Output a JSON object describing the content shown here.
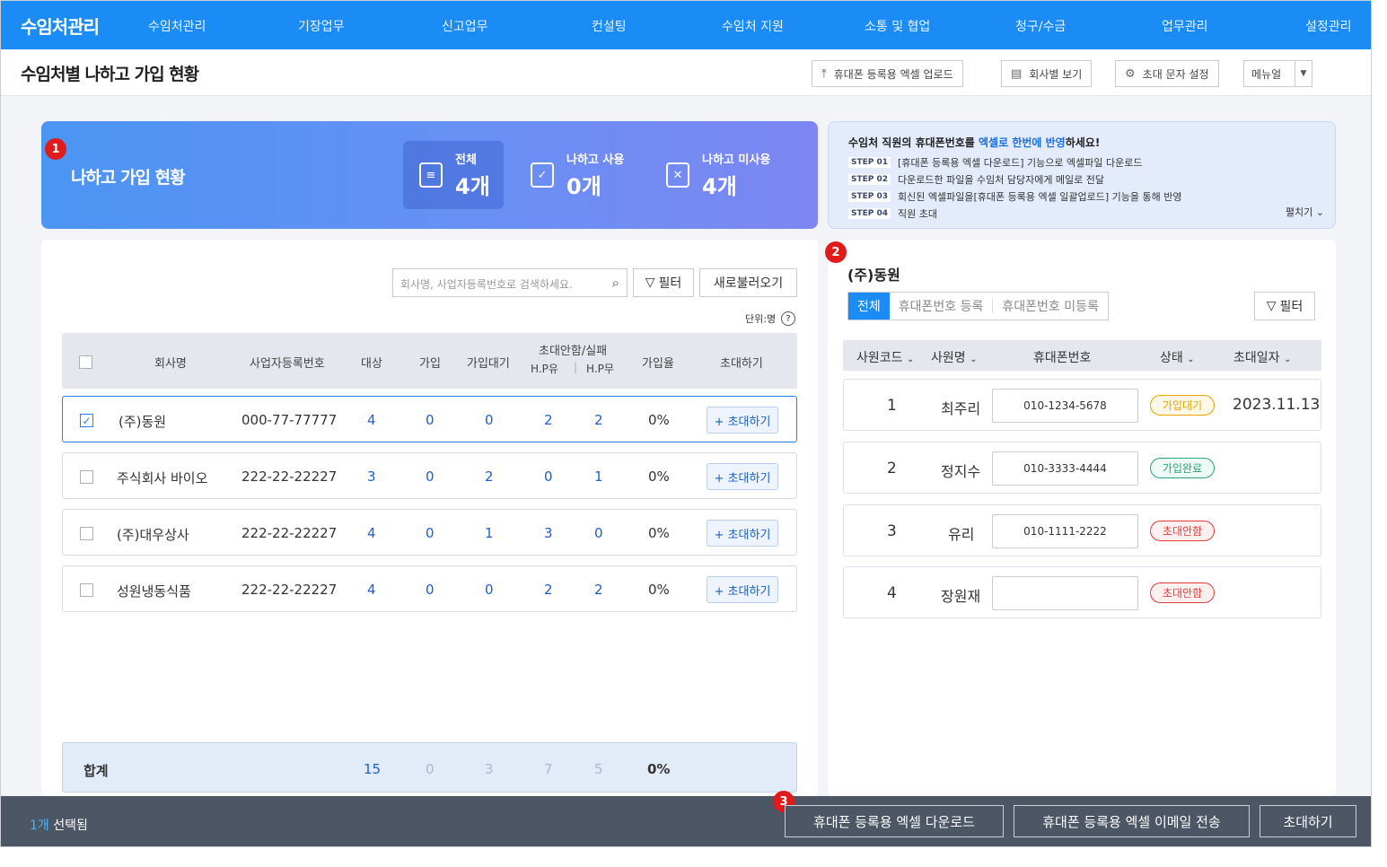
{
  "nav": {
    "brand": "수임처관리",
    "items": [
      "수임처관리",
      "기장업무",
      "신고업무",
      "컨설팅",
      "수임처 지원",
      "소통 및 협업",
      "청구/수금",
      "업무관리",
      "설정관리"
    ]
  },
  "header": {
    "title": "수임처별 나하고 가입 현황",
    "buttons": {
      "upload": "휴대폰 등록용 엑셀 업로드",
      "by_company": "회사별 보기",
      "sms_settings": "초대 문자 설정",
      "manual": "메뉴얼"
    }
  },
  "badges": [
    "1",
    "2",
    "3"
  ],
  "status_card": {
    "label": "나하고 가입 현황",
    "stats": [
      {
        "title": "전체",
        "value": "4개"
      },
      {
        "title": "나하고 사용",
        "value": "0개"
      },
      {
        "title": "나하고 미사용",
        "value": "4개"
      }
    ]
  },
  "info": {
    "title_pre": "수임처 직원의 휴대폰번호를 ",
    "title_hl1": "엑셀로",
    "title_hl2": "한번에 반영",
    "title_post": "하세요!",
    "steps": [
      {
        "no": "STEP 01",
        "text": "[휴대폰 등록용 엑셀 다운로드] 기능으로 엑셀파일 다운로드"
      },
      {
        "no": "STEP 02",
        "text": "다운로드한 파일을 수임처 담당자에게 메일로 전달"
      },
      {
        "no": "STEP 03",
        "text": "회신된 엑셀파일을[휴대폰 등록용 엑셀 일괄업로드] 기능을 통해 반영"
      },
      {
        "no": "STEP 04",
        "text": "직원 초대"
      }
    ],
    "more": "펼치기"
  },
  "left": {
    "search_placeholder": "회사명, 사업자등록번호로 검색하세요.",
    "filter_label": "필터",
    "refresh_label": "새로불러오기",
    "unit": "단위:명",
    "columns": {
      "company": "회사명",
      "bizno": "사업자등록번호",
      "target": "대상",
      "joined": "가입",
      "waiting": "가입대기",
      "invite_fail": "초대안함/실패",
      "hp_yes": "H.P유",
      "hp_no": "H.P무",
      "rate": "가입율",
      "invite": "초대하기"
    },
    "rows": [
      {
        "checked": true,
        "company": "(주)동원",
        "bizno": "000-77-77777",
        "target": "4",
        "joined": "0",
        "waiting": "0",
        "hp_yes": "2",
        "hp_no": "2",
        "rate": "0%",
        "invite": "+ 초대하기"
      },
      {
        "checked": false,
        "company": "주식회사 바이오",
        "bizno": "222-22-22227",
        "target": "3",
        "joined": "0",
        "waiting": "2",
        "hp_yes": "0",
        "hp_no": "1",
        "rate": "0%",
        "invite": "+ 초대하기"
      },
      {
        "checked": false,
        "company": "(주)대우상사",
        "bizno": "222-22-22227",
        "target": "4",
        "joined": "0",
        "waiting": "1",
        "hp_yes": "3",
        "hp_no": "0",
        "rate": "0%",
        "invite": "+ 초대하기"
      },
      {
        "checked": false,
        "company": "성원냉동식품",
        "bizno": "222-22-22227",
        "target": "4",
        "joined": "0",
        "waiting": "0",
        "hp_yes": "2",
        "hp_no": "2",
        "rate": "0%",
        "invite": "+ 초대하기"
      }
    ],
    "total": {
      "label": "합계",
      "target": "15",
      "joined": "0",
      "waiting": "3",
      "hp_yes": "7",
      "hp_no": "5",
      "rate": "0%"
    }
  },
  "right": {
    "title": "(주)동원",
    "tabs": [
      "전체",
      "휴대폰번호 등록",
      "휴대폰번호 미등록"
    ],
    "filter_label": "필터",
    "columns": {
      "code": "사원코드",
      "name": "사원명",
      "phone": "휴대폰번호",
      "status": "상태",
      "date": "초대일자"
    },
    "rows": [
      {
        "code": "1",
        "name": "최주리",
        "phone": "010-1234-5678",
        "status": "가입대기",
        "date": "2023.11.13"
      },
      {
        "code": "2",
        "name": "정지수",
        "phone": "010-3333-4444",
        "status": "가입완료",
        "date": ""
      },
      {
        "code": "3",
        "name": "유리",
        "phone": "010-1111-2222",
        "status": "초대안함",
        "date": ""
      },
      {
        "code": "4",
        "name": "장원재",
        "phone": "",
        "status": "초대안함",
        "date": ""
      }
    ]
  },
  "bottom": {
    "count": "1개",
    "selected": " 선택됨",
    "download": "휴대폰 등록용 엑셀 다운로드",
    "email": "휴대폰 등록용 엑셀 이메일 전송",
    "invite": "초대하기"
  },
  "colors": {
    "nav": "#1b8cf5",
    "accent_blue": "#1f5fc8",
    "status_waiting": "#e8a400",
    "status_done": "#2aa37a",
    "status_none": "#e23d3d",
    "bottom_bar": "#4d5665"
  }
}
